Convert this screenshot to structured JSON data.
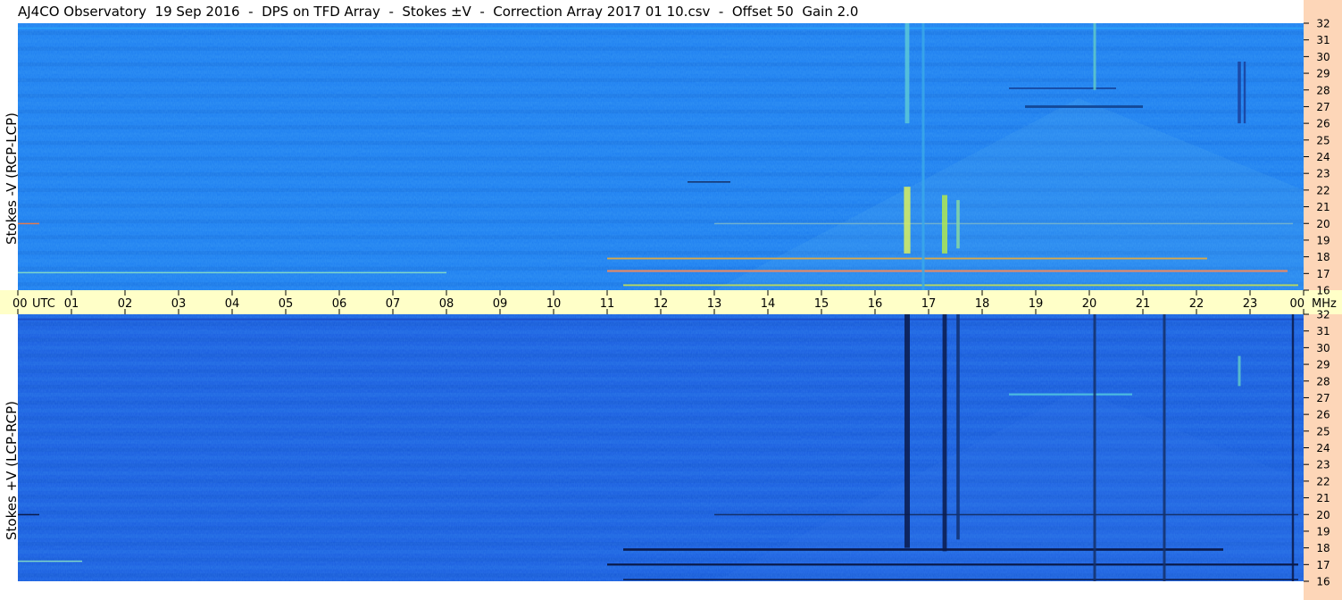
{
  "header": {
    "title": "AJ4CO Observatory  19 Sep 2016  -  DPS on TFD Array  -  Stokes ±V  -  Correction Array 2017 01 10.csv  -  Offset 50  Gain 2.0"
  },
  "chart_data": {
    "type": "heatmap",
    "title": "AJ4CO Observatory  19 Sep 2016  -  DPS on TFD Array  -  Stokes ±V  -  Correction Array 2017 01 10.csv  -  Offset 50  Gain 2.0",
    "x": {
      "unit_label": "UTC",
      "tick_labels": [
        "00",
        "01",
        "02",
        "03",
        "04",
        "05",
        "06",
        "07",
        "08",
        "09",
        "10",
        "11",
        "12",
        "13",
        "14",
        "15",
        "16",
        "17",
        "18",
        "19",
        "20",
        "21",
        "22",
        "23",
        "00"
      ],
      "range": [
        0,
        24
      ]
    },
    "y": {
      "unit_label": "MHz",
      "tick_labels": [
        "16",
        "17",
        "18",
        "19",
        "20",
        "21",
        "22",
        "23",
        "24",
        "25",
        "26",
        "27",
        "28",
        "29",
        "30",
        "31",
        "32"
      ],
      "range": [
        16,
        32
      ]
    },
    "panels": [
      {
        "name": "Stokes -V (RCP-LCP)",
        "base_color": "#1f7ff0",
        "features": [
          {
            "kind": "h",
            "t0": 11.0,
            "t1": 22.2,
            "f": 17.9,
            "w": 0.1,
            "color": "#d8a84a"
          },
          {
            "kind": "h",
            "t0": 11.0,
            "t1": 23.7,
            "f": 17.15,
            "w": 0.12,
            "color": "#e08a6a"
          },
          {
            "kind": "h",
            "t0": 11.3,
            "t1": 23.9,
            "f": 16.3,
            "w": 0.1,
            "color": "#b8d860"
          },
          {
            "kind": "h",
            "t0": 0.0,
            "t1": 8.0,
            "f": 17.05,
            "w": 0.08,
            "color": "#7fd6c8"
          },
          {
            "kind": "h",
            "t0": 0.0,
            "t1": 0.4,
            "f": 20.0,
            "w": 0.06,
            "color": "#e07a50"
          },
          {
            "kind": "h",
            "t0": 13.0,
            "t1": 23.8,
            "f": 20.0,
            "w": 0.06,
            "color": "#6fb0d0"
          },
          {
            "kind": "h",
            "t0": 18.5,
            "t1": 20.5,
            "f": 28.1,
            "w": 0.08,
            "color": "#123a90"
          },
          {
            "kind": "h",
            "t0": 18.8,
            "t1": 21.0,
            "f": 27.0,
            "w": 0.16,
            "color": "#134a9a"
          },
          {
            "kind": "h",
            "t0": 12.5,
            "t1": 13.3,
            "f": 22.5,
            "w": 0.05,
            "color": "#14306a"
          },
          {
            "kind": "h",
            "t0": 0.0,
            "t1": 24.0,
            "f": 31.7,
            "w": 0.1,
            "color": "#2aa0f8"
          },
          {
            "kind": "v",
            "t": 16.6,
            "f0": 18.2,
            "f1": 22.2,
            "w": 0.12,
            "color": "#d8f060"
          },
          {
            "kind": "v",
            "t": 16.6,
            "f0": 26.0,
            "f1": 32.0,
            "w": 0.08,
            "color": "#5cc8d8"
          },
          {
            "kind": "v",
            "t": 17.3,
            "f0": 18.2,
            "f1": 21.7,
            "w": 0.1,
            "color": "#b0e850"
          },
          {
            "kind": "v",
            "t": 17.55,
            "f0": 18.5,
            "f1": 21.4,
            "w": 0.06,
            "color": "#8ad8a0"
          },
          {
            "kind": "v",
            "t": 16.9,
            "f0": 16.0,
            "f1": 32.0,
            "w": 0.05,
            "color": "#3aa8e8"
          },
          {
            "kind": "v",
            "t": 20.1,
            "f0": 28.0,
            "f1": 32.0,
            "w": 0.05,
            "color": "#60c8c8"
          },
          {
            "kind": "v",
            "t": 22.8,
            "f0": 26.0,
            "f1": 29.7,
            "w": 0.06,
            "color": "#1a3f9a"
          },
          {
            "kind": "v",
            "t": 22.9,
            "f0": 26.0,
            "f1": 29.7,
            "w": 0.04,
            "color": "#1a3f9a"
          }
        ]
      },
      {
        "name": "Stokes +V (LCP-RCP)",
        "base_color": "#1c5fe0",
        "features": [
          {
            "kind": "h",
            "t0": 11.0,
            "t1": 23.9,
            "f": 17.0,
            "w": 0.12,
            "color": "#0a1a4a"
          },
          {
            "kind": "h",
            "t0": 11.3,
            "t1": 22.5,
            "f": 17.9,
            "w": 0.14,
            "color": "#0a1a4a"
          },
          {
            "kind": "h",
            "t0": 11.3,
            "t1": 23.9,
            "f": 16.1,
            "w": 0.08,
            "color": "#0a1a4a"
          },
          {
            "kind": "h",
            "t0": 0.0,
            "t1": 0.4,
            "f": 20.0,
            "w": 0.06,
            "color": "#0a1a4a"
          },
          {
            "kind": "h",
            "t0": 13.0,
            "t1": 23.9,
            "f": 20.0,
            "w": 0.06,
            "color": "#14306a"
          },
          {
            "kind": "h",
            "t0": 0.0,
            "t1": 1.2,
            "f": 17.2,
            "w": 0.08,
            "color": "#7fd6c8"
          },
          {
            "kind": "h",
            "t0": 18.5,
            "t1": 20.8,
            "f": 27.2,
            "w": 0.12,
            "color": "#4ab8e0"
          },
          {
            "kind": "h",
            "t0": 0.0,
            "t1": 24.0,
            "f": 31.7,
            "w": 0.1,
            "color": "#1a4fc8"
          },
          {
            "kind": "v",
            "t": 16.6,
            "f0": 18.0,
            "f1": 32.0,
            "w": 0.1,
            "color": "#0a1a4a"
          },
          {
            "kind": "v",
            "t": 17.3,
            "f0": 17.8,
            "f1": 32.0,
            "w": 0.08,
            "color": "#0a1a4a"
          },
          {
            "kind": "v",
            "t": 17.55,
            "f0": 18.5,
            "f1": 32.0,
            "w": 0.06,
            "color": "#12306e"
          },
          {
            "kind": "v",
            "t": 20.1,
            "f0": 16.0,
            "f1": 32.0,
            "w": 0.05,
            "color": "#14306a"
          },
          {
            "kind": "v",
            "t": 21.4,
            "f0": 16.0,
            "f1": 32.0,
            "w": 0.05,
            "color": "#14306a"
          },
          {
            "kind": "v",
            "t": 22.8,
            "f0": 27.7,
            "f1": 29.5,
            "w": 0.05,
            "color": "#60c8c8"
          },
          {
            "kind": "v",
            "t": 23.8,
            "f0": 16.0,
            "f1": 32.0,
            "w": 0.04,
            "color": "#0a1a4a"
          }
        ]
      }
    ]
  }
}
